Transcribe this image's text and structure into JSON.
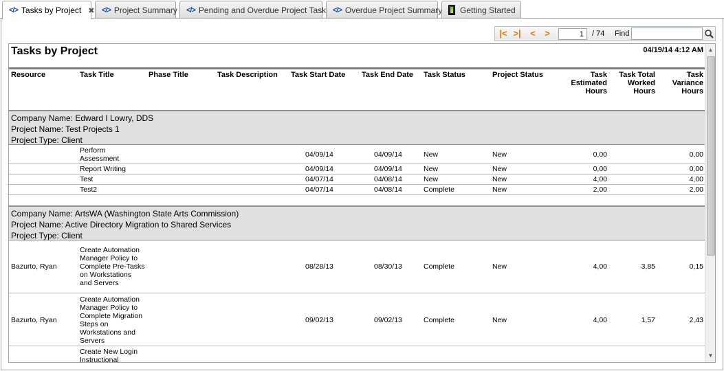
{
  "tabs": [
    {
      "label": "Tasks by Project",
      "active": true,
      "closable": true,
      "icon": "code-icon"
    },
    {
      "label": "Project Summary",
      "icon": "code-icon"
    },
    {
      "label": "Pending and Overdue Project Tasks",
      "icon": "code-icon"
    },
    {
      "label": "Overdue Project Summary",
      "icon": "code-icon"
    },
    {
      "label": "Getting Started",
      "icon": "getting-started-icon"
    }
  ],
  "toolbar": {
    "current_page": "1",
    "total_pages": "/ 74",
    "find_label": "Find",
    "find_value": "",
    "nav_icons": [
      "first-page-icon",
      "last-page-icon",
      "prev-page-icon",
      "next-page-icon"
    ]
  },
  "report": {
    "title": "Tasks by Project",
    "timestamp": "04/19/14 4:12 AM",
    "columns": {
      "resource": "Resource",
      "task_title": "Task Title",
      "phase_title": "Phase Title",
      "task_description": "Task Description",
      "task_start_date": "Task Start Date",
      "task_end_date": "Task End Date",
      "task_status": "Task Status",
      "project_status": "Project Status",
      "estimated_1": "Task",
      "estimated_2": "Estimated",
      "estimated_3": "Hours",
      "worked_1": "Task Total",
      "worked_2": "Worked",
      "worked_3": "Hours",
      "variance_1": "Task",
      "variance_2": "Variance",
      "variance_3": "Hours"
    },
    "groups": [
      {
        "company": "Company Name:  Edward I Lowry, DDS",
        "project": "Project Name: Test Projects 1",
        "type": "Project Type: Client",
        "rows": [
          {
            "resource": "",
            "title_1": "Perform",
            "title_2": "Assessment",
            "start": "04/09/14",
            "end": "04/09/14",
            "status": "New",
            "project_status": "New",
            "estimated": "0,00",
            "worked": "",
            "variance": "0,00"
          },
          {
            "resource": "",
            "title_1": "Report Writing",
            "start": "04/09/14",
            "end": "04/09/14",
            "status": "New",
            "project_status": "New",
            "estimated": "0,00",
            "worked": "",
            "variance": "0,00"
          },
          {
            "resource": "",
            "title_1": "Test",
            "start": "04/07/14",
            "end": "04/08/14",
            "status": "New",
            "project_status": "New",
            "estimated": "4,00",
            "worked": "",
            "variance": "4,00"
          },
          {
            "resource": "",
            "title_1": "Test2",
            "start": "04/07/14",
            "end": "04/08/14",
            "status": "Complete",
            "project_status": "New",
            "estimated": "2,00",
            "worked": "",
            "variance": "2,00"
          }
        ]
      },
      {
        "company": "Company Name: ArtsWA (Washington State Arts Commission)",
        "project": "Project Name: Active Directory Migration to Shared Services",
        "type": "Project Type: Client",
        "rows": [
          {
            "resource": "Bazurto, Ryan",
            "title_1": "Create Automation",
            "title_2": "Manager Policy to",
            "title_3": "Complete Pre-Tasks",
            "title_4": "on Workstations",
            "title_5": "and Servers",
            "start": "08/28/13",
            "end": "08/30/13",
            "status": "Complete",
            "project_status": "New",
            "estimated": "4,00",
            "worked": "3,85",
            "variance": "0,15"
          },
          {
            "resource": "Bazurto, Ryan",
            "title_1": "Create Automation",
            "title_2": "Manager Policy to",
            "title_3": "Complete Migration",
            "title_4": "Steps on",
            "title_5": "Workstations and",
            "title_6": "Servers",
            "start": "09/02/13",
            "end": "09/02/13",
            "status": "Complete",
            "project_status": "New",
            "estimated": "4,00",
            "worked": "1,57",
            "variance": "2,43"
          },
          {
            "resource": "",
            "title_1": "Create New Login",
            "title_2": "Instructional"
          }
        ]
      }
    ]
  }
}
